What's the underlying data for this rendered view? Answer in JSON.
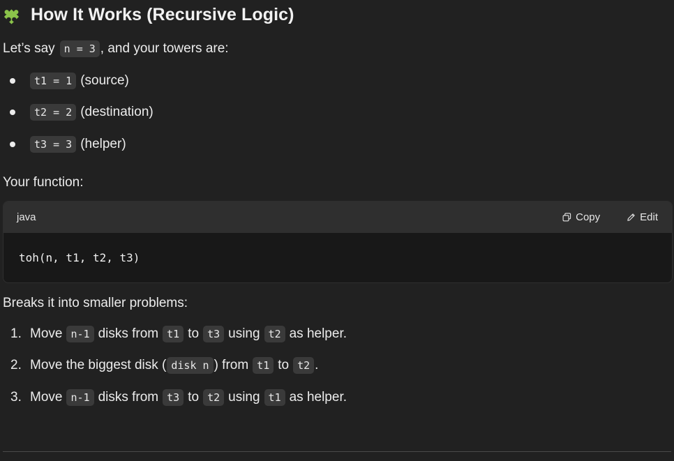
{
  "heading": {
    "title": "How It Works (Recursive Logic)",
    "icon": "puzzle-piece-icon",
    "icon_color": "#8bc34a"
  },
  "intro": {
    "text_before": "Let’s say",
    "code": "n = 3",
    "text_after": ", and your towers are:"
  },
  "towers": [
    {
      "code": "t1 = 1",
      "desc": "(source)"
    },
    {
      "code": "t2 = 2",
      "desc": "(destination)"
    },
    {
      "code": "t3 = 3",
      "desc": "(helper)"
    }
  ],
  "function_label": "Your function:",
  "code_block": {
    "language": "java",
    "copy_label": "Copy",
    "edit_label": "Edit",
    "code": "toh(n, t1, t2, t3)"
  },
  "breaks_label": "Breaks it into smaller problems:",
  "steps": [
    {
      "num": "1.",
      "parts": [
        "Move",
        "n-1",
        "disks from",
        "t1",
        "to",
        "t3",
        "using",
        "t2",
        "as helper."
      ]
    },
    {
      "num": "2.",
      "parts": [
        "Move the biggest disk (",
        "disk n",
        ") from",
        "t1",
        "to",
        "t2",
        "."
      ]
    },
    {
      "num": "3.",
      "parts": [
        "Move",
        "n-1",
        "disks from",
        "t3",
        "to",
        "t2",
        "using",
        "t1",
        "as helper."
      ]
    }
  ],
  "colors": {
    "background": "#212121",
    "inline_code_bg": "#3a3a3a",
    "code_header_bg": "#2f2f2f",
    "code_body_bg": "#181818"
  }
}
